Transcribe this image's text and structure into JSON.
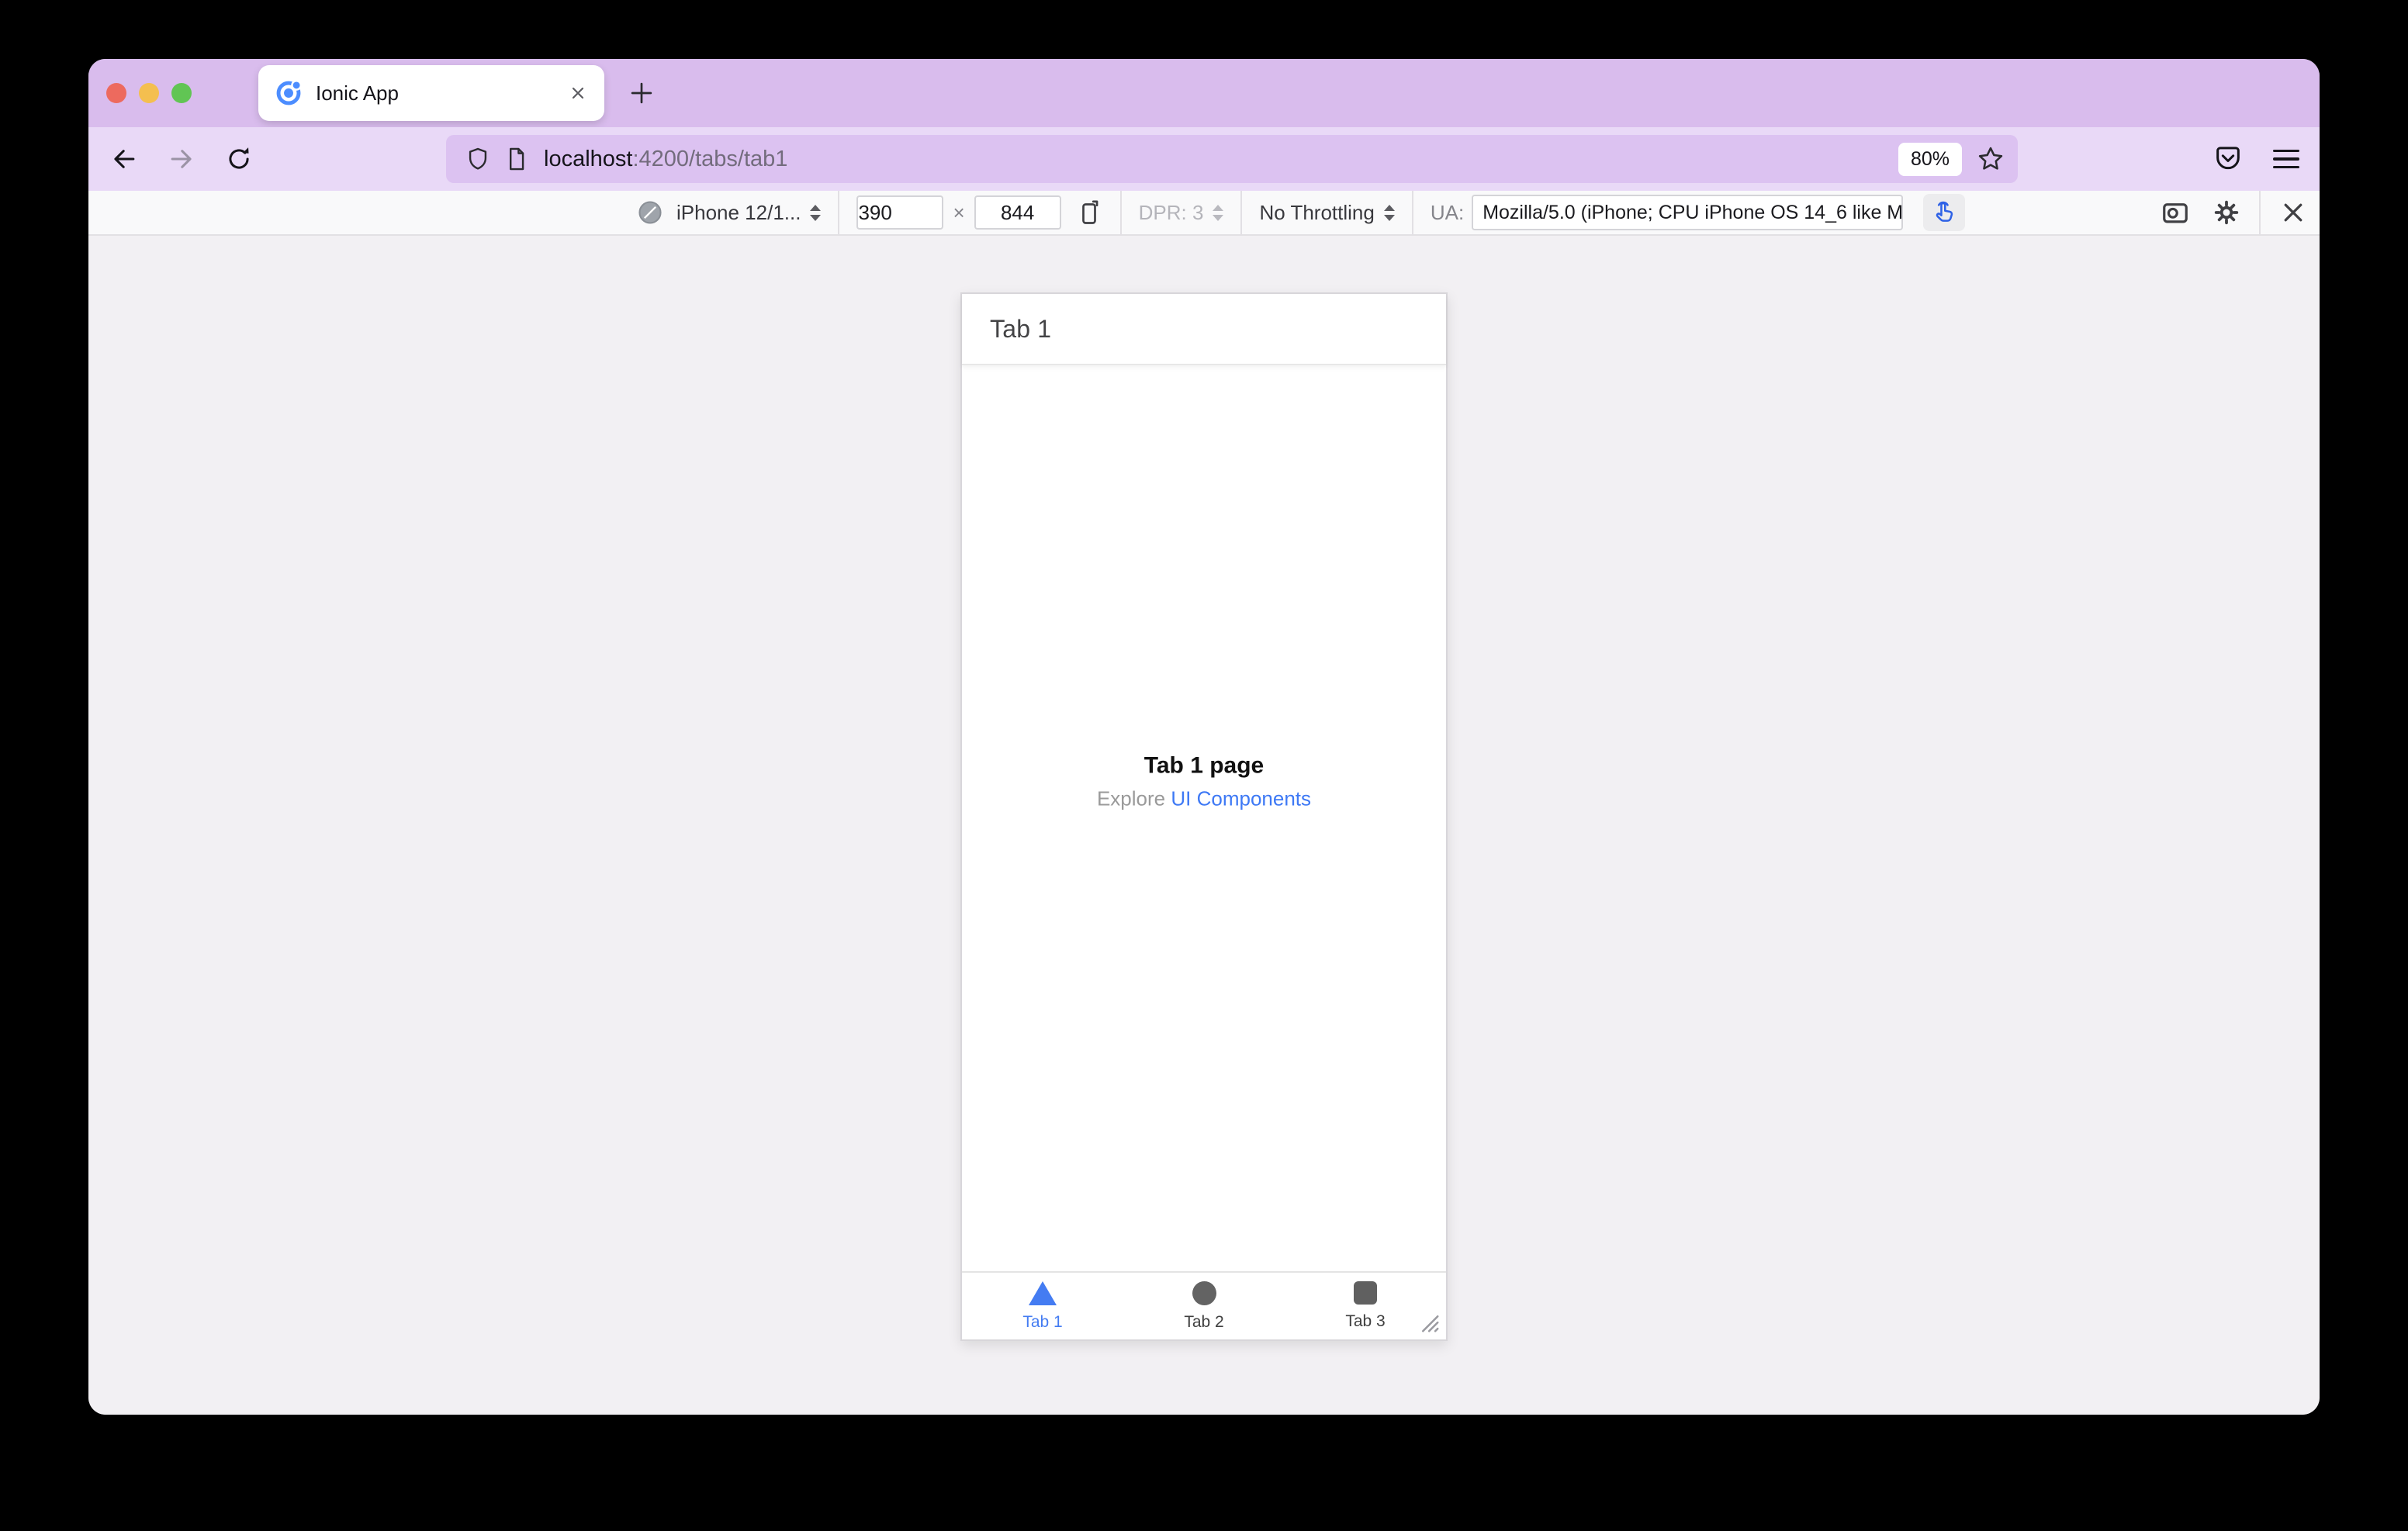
{
  "titlebar": {
    "tab_title": "Ionic App"
  },
  "navbar": {
    "url_host": "localhost",
    "url_rest": ":4200/tabs/tab1",
    "zoom_level": "80%"
  },
  "rdm_toolbar": {
    "device": "iPhone 12/1...",
    "viewport_width": "390",
    "dimension_separator": "×",
    "viewport_height": "844",
    "dpr": "DPR: 3",
    "throttling": "No Throttling",
    "ua_label": "UA:",
    "ua_value": "Mozilla/5.0 (iPhone; CPU iPhone OS 14_6 like M"
  },
  "app": {
    "header_title": "Tab 1",
    "page_title": "Tab 1 page",
    "explore_text": "Explore",
    "explore_link": "UI Components",
    "tabs": [
      {
        "label": "Tab 1",
        "icon": "triangle-icon",
        "active": true
      },
      {
        "label": "Tab 2",
        "icon": "circle-icon",
        "active": false
      },
      {
        "label": "Tab 3",
        "icon": "square-icon",
        "active": false
      }
    ]
  },
  "colors": {
    "titlebar_purple": "#d9bced",
    "navbar_purple": "#e9d9f7",
    "urlbar_purple": "#dcc2f1",
    "toolbar_bg": "#f9f9fa",
    "link_blue": "#3e79f5",
    "active_tab_blue": "#447cf2",
    "touch_icon_blue": "#2f62e6",
    "traffic_red": "#ed6a5e",
    "traffic_yellow": "#f4bf4f",
    "traffic_green": "#61c554"
  }
}
